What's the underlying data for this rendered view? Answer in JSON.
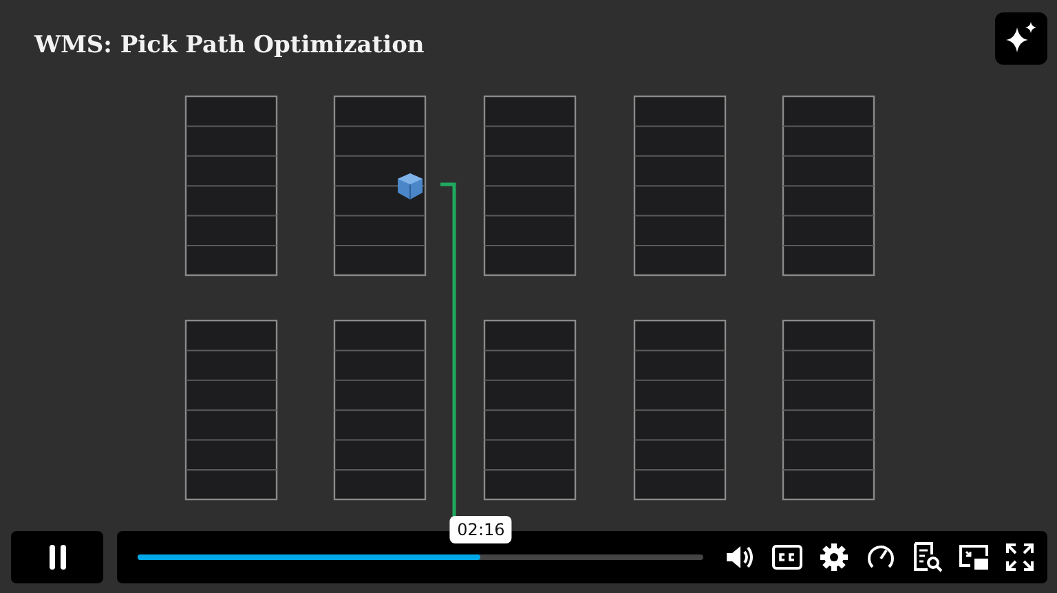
{
  "video": {
    "title": "WMS: Pick Path Optimization"
  },
  "player": {
    "playing": true,
    "progress": {
      "level": 0.607
    },
    "time_tooltip": "02:16"
  }
}
